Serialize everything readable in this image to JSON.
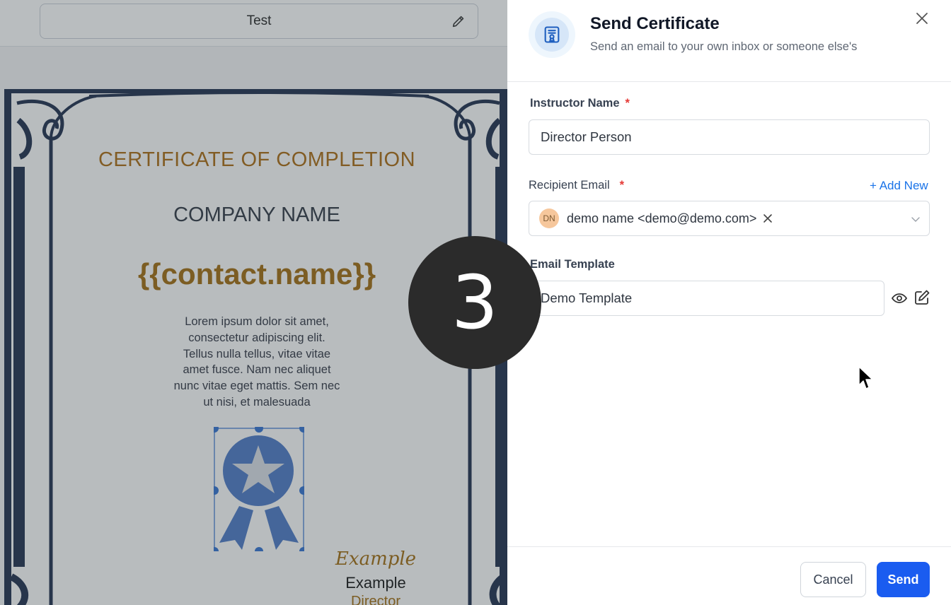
{
  "editor": {
    "certificate_name": "Test",
    "certificate": {
      "title": "CERTIFICATE OF COMPLETION",
      "company": "COMPANY NAME",
      "placeholder": "{{contact.name}}",
      "body_lines": [
        "Lorem ipsum dolor sit amet,",
        "consectetur adipiscing elit.",
        "Tellus nulla tellus, vitae vitae",
        "amet fusce. Nam nec aliquet",
        "nunc vitae eget mattis. Sem nec",
        "ut nisi, et malesuada"
      ],
      "signature_script": "Example",
      "signature_name": "Example",
      "signature_role": "Director"
    }
  },
  "step_marker": "3",
  "drawer": {
    "title": "Send Certificate",
    "subtitle": "Send an email to your own inbox or someone else's",
    "instructor": {
      "label": "Instructor Name",
      "required_mark": "*",
      "value": "Director Person"
    },
    "recipient": {
      "label": "Recipient Email",
      "required_mark": "*",
      "add_new": "+ Add New",
      "chip": {
        "initials": "DN",
        "text": "demo name <demo@demo.com>"
      }
    },
    "template": {
      "label": "Email Template",
      "value": "Demo Template"
    },
    "footer": {
      "cancel": "Cancel",
      "send": "Send"
    }
  },
  "colors": {
    "primary_button": "#1a5cf0",
    "link": "#1a73e8",
    "required": "#e53935",
    "certificate_accent": "#a06a0c",
    "frame_navy": "#1c2b4a",
    "badge_blue": "#4a78c6"
  },
  "icons": {
    "edit_name": "pencil-icon",
    "header": "certificate-icon",
    "close": "close-icon",
    "chip_remove": "x-icon",
    "dropdown": "chevron-down-icon",
    "preview": "eye-icon",
    "edit_template": "edit-icon"
  }
}
